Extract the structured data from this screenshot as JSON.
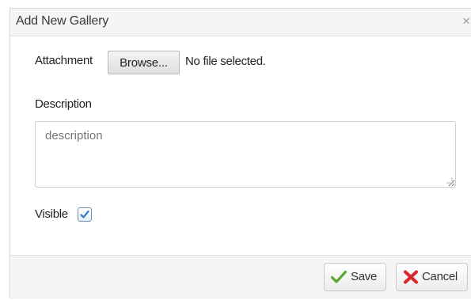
{
  "dialog": {
    "title": "Add New Gallery",
    "close_symbol": "×"
  },
  "form": {
    "attachment_label": "Attachment",
    "browse_label": "Browse...",
    "file_status": "No file selected.",
    "description_label": "Description",
    "description_placeholder": "description",
    "description_value": "",
    "visible_label": "Visible",
    "visible_checked": true
  },
  "footer": {
    "save_label": "Save",
    "cancel_label": "Cancel"
  },
  "icons": {
    "close": "close-icon",
    "check": "checkmark-icon",
    "save": "green-check-icon",
    "cancel": "red-x-icon"
  },
  "colors": {
    "header_bg": "#f5f5f5",
    "save_icon": "#5aa832",
    "cancel_icon": "#d9282b",
    "check_accent": "#2f79c2"
  }
}
